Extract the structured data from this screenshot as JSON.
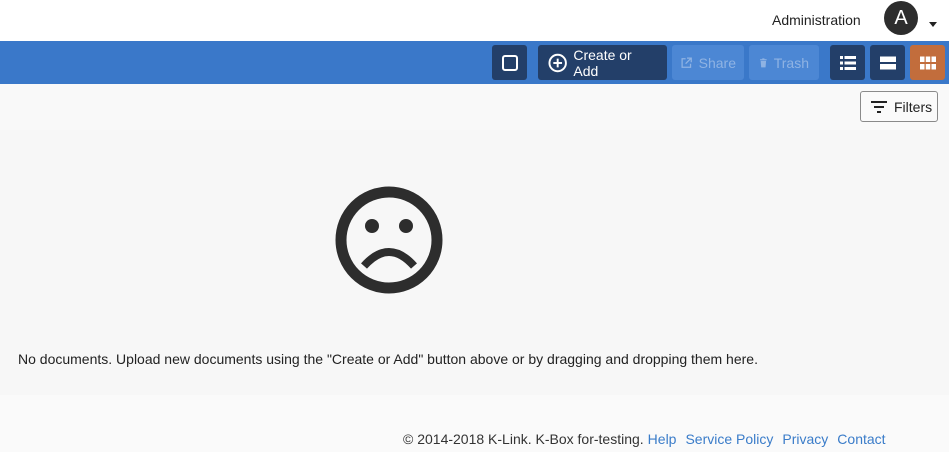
{
  "header": {
    "admin_label": "Administration",
    "avatar_initial": "A"
  },
  "toolbar": {
    "create_label": "Create or Add",
    "share_label": "Share",
    "trash_label": "Trash",
    "icons": [
      "checkbox-icon",
      "plus-circle-icon",
      "share-icon",
      "trash-icon",
      "list-view-icon",
      "card-view-icon",
      "grid-view-icon"
    ],
    "colors": {
      "bar": "#3a78c9",
      "button_dark": "#233f69",
      "button_disabled": "#4c87d4",
      "active_view": "#c26d3c"
    }
  },
  "filters": {
    "label": "Filters"
  },
  "empty_state": {
    "icon": "sad-face-icon",
    "message": "No documents. Upload new documents using the \"Create or Add\" button above or by dragging and dropping them here."
  },
  "footer": {
    "copyright": "© 2014-2018 K-Link. K-Box for-testing.",
    "links": [
      "Help",
      "Service Policy",
      "Privacy",
      "Contact"
    ],
    "link_color": "#3a7cc9"
  }
}
